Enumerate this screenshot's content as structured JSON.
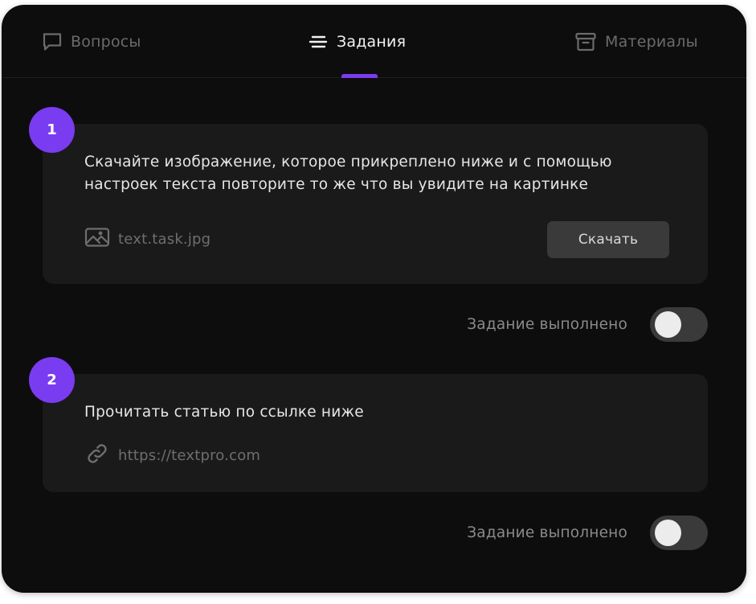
{
  "tabs": [
    {
      "label": "Вопросы",
      "icon": "chat-bubble-icon",
      "active": false
    },
    {
      "label": "Задания",
      "icon": "menu-lines-icon",
      "active": true
    },
    {
      "label": "Материалы",
      "icon": "archive-box-icon",
      "active": false
    }
  ],
  "colors": {
    "accent": "#7a3cf0",
    "background": "#0d0d0d",
    "card": "#1a1a1a",
    "button": "#3a3a3a"
  },
  "tasks": [
    {
      "number": "1",
      "text": "Скачайте изображение, которое прикреплено ниже и с помощью настроек текста повторите то же что вы увидите на картинке",
      "attachment": {
        "icon": "image-icon",
        "label": "text.task.jpg"
      },
      "button_label": "Скачать",
      "done_label": "Задание выполнено",
      "done": false
    },
    {
      "number": "2",
      "text": "Прочитать статью по ссылке ниже",
      "attachment": {
        "icon": "link-icon",
        "label": "https://textpro.com"
      },
      "done_label": "Задание выполнено",
      "done": false
    }
  ]
}
